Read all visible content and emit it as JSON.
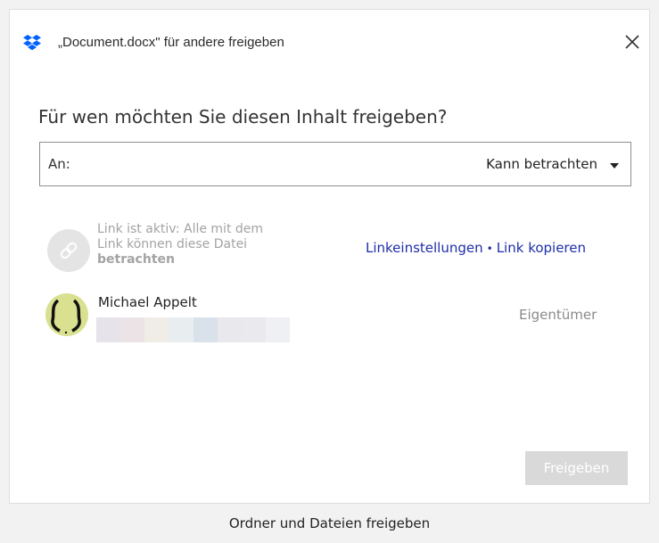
{
  "window": {
    "title": "„Document.docx\" für andere freigeben",
    "close_label": "×"
  },
  "dialog": {
    "heading": "Für wen möchten Sie diesen Inhalt freigeben?"
  },
  "to_field": {
    "label": "An:",
    "value": "",
    "permission": "Kann betrachten"
  },
  "link": {
    "status_line1": "Link ist aktiv: Alle mit dem",
    "status_line2": "Link können diese Datei",
    "status_line3": "betrachten",
    "settings_label": "Linkeinstellungen",
    "separator": "•",
    "copy_label": "Link kopieren"
  },
  "members": [
    {
      "name": "Michael Appelt",
      "role": "Eigentümer",
      "email_pixel_colors": [
        "#e6e3ea",
        "#ece3e6",
        "#f0ede6",
        "#e8edf0",
        "#d9e2ea",
        "#e9e9ed",
        "#eae9ee",
        "#eef0f4"
      ]
    }
  ],
  "actions": {
    "share_label": "Freigeben"
  },
  "caption": "Ordner und Dateien freigeben",
  "colors": {
    "link_blue": "#1f2ea8",
    "dropbox_blue": "#0061fe",
    "disabled_button": "#d9d9d9",
    "avatar_bg": "#d9e08f"
  },
  "icons": {
    "logo": "dropbox-logo",
    "close": "close-icon",
    "link": "link-icon",
    "dropdown": "chevron-down-icon"
  }
}
